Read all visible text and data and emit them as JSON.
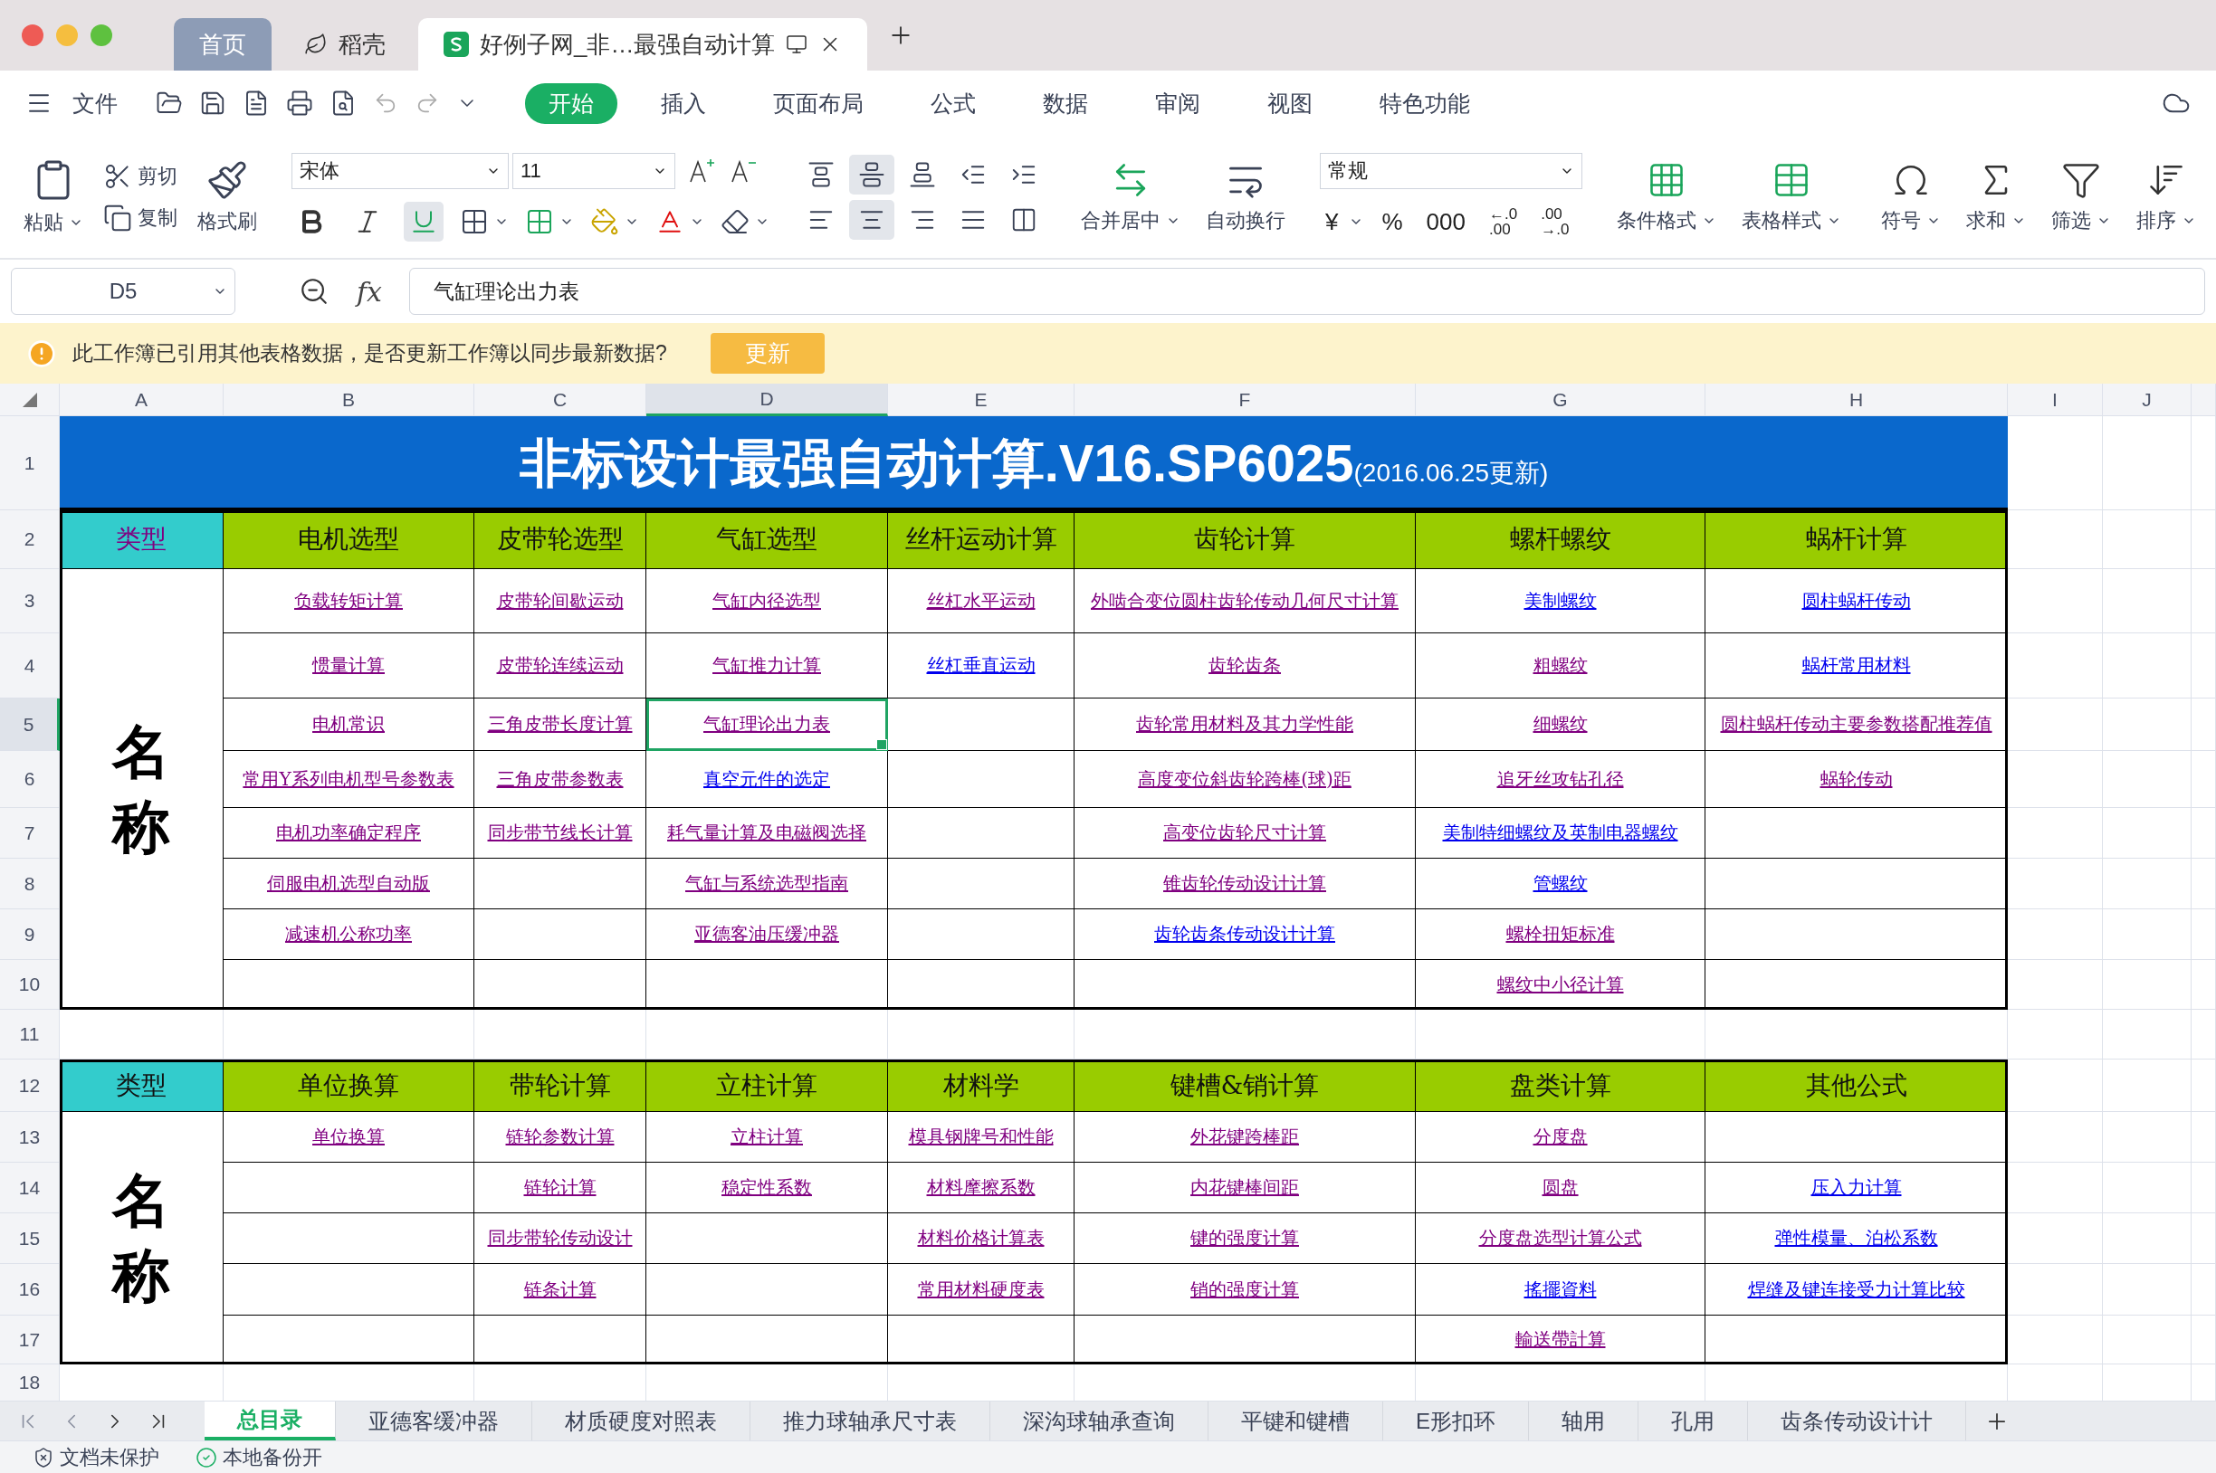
{
  "window_tabs": [
    {
      "label": "首页",
      "kind": "home",
      "selected": false
    },
    {
      "label": "稻壳",
      "kind": "store",
      "selected": false
    },
    {
      "label": "好例子网_非…最强自动计算",
      "kind": "document",
      "selected": true
    }
  ],
  "menu": {
    "file": "文件",
    "tabs": [
      {
        "label": "开始",
        "selected": true
      },
      {
        "label": "插入",
        "selected": false
      },
      {
        "label": "页面布局",
        "selected": false
      },
      {
        "label": "公式",
        "selected": false
      },
      {
        "label": "数据",
        "selected": false
      },
      {
        "label": "审阅",
        "selected": false
      },
      {
        "label": "视图",
        "selected": false
      },
      {
        "label": "特色功能",
        "selected": false
      }
    ]
  },
  "ribbon": {
    "paste": "粘贴",
    "cut": "剪切",
    "copy": "复制",
    "format_painter": "格式刷",
    "font_name": "宋体",
    "font_size": "11",
    "format_buttons": [
      {
        "kind": "bold",
        "selected": false
      },
      {
        "kind": "italic",
        "selected": false
      },
      {
        "kind": "underline",
        "selected": true
      }
    ],
    "align_buttons": [
      {
        "kind": "top",
        "selected": false
      },
      {
        "kind": "middle",
        "selected": true
      },
      {
        "kind": "bottom",
        "selected": false
      },
      {
        "kind": "outdent",
        "selected": false
      },
      {
        "kind": "indent",
        "selected": false
      },
      {
        "kind": "left",
        "selected": false
      },
      {
        "kind": "center",
        "selected": true
      },
      {
        "kind": "right",
        "selected": false
      },
      {
        "kind": "justify",
        "selected": false
      },
      {
        "kind": "distribute",
        "selected": false
      }
    ],
    "merge": "合并居中",
    "wrap": "自动换行",
    "number_format": "常规",
    "number_buttons": [
      {
        "kind": "dropdown",
        "label": "¥"
      },
      {
        "kind": "plain",
        "label": "%"
      },
      {
        "kind": "plain",
        "label": "000"
      },
      {
        "kind": "stack",
        "label": "←.0 .00"
      },
      {
        "kind": "stack",
        "label": ".00 →.0"
      }
    ],
    "tools": [
      {
        "kind": "conditional",
        "label": "条件格式"
      },
      {
        "kind": "table_style",
        "label": "表格样式"
      },
      {
        "kind": "symbol",
        "label": "符号"
      },
      {
        "kind": "sum",
        "label": "求和"
      },
      {
        "kind": "filter",
        "label": "筛选"
      },
      {
        "kind": "sort",
        "label": "排序"
      }
    ]
  },
  "formula_bar": {
    "name_box": "D5",
    "function_label": "fx",
    "formula": "气缸理论出力表"
  },
  "notice": {
    "message": "此工作簿已引用其他表格数据，是否更新工作簿以同步最新数据?",
    "button": "更新"
  },
  "sheet": {
    "column_letters": [
      {
        "label": "A",
        "selected": false
      },
      {
        "label": "B",
        "selected": false
      },
      {
        "label": "C",
        "selected": false
      },
      {
        "label": "D",
        "selected": true
      },
      {
        "label": "E",
        "selected": false
      },
      {
        "label": "F",
        "selected": false
      },
      {
        "label": "G",
        "selected": false
      },
      {
        "label": "H",
        "selected": false
      },
      {
        "label": "I",
        "selected": false
      },
      {
        "label": "J",
        "selected": false
      }
    ],
    "row_numbers": [
      {
        "label": "1",
        "selected": false
      },
      {
        "label": "2",
        "selected": false
      },
      {
        "label": "3",
        "selected": false
      },
      {
        "label": "4",
        "selected": false
      },
      {
        "label": "5",
        "selected": true
      },
      {
        "label": "6",
        "selected": false
      },
      {
        "label": "7",
        "selected": false
      },
      {
        "label": "8",
        "selected": false
      },
      {
        "label": "9",
        "selected": false
      },
      {
        "label": "10",
        "selected": false
      },
      {
        "label": "11",
        "selected": false
      },
      {
        "label": "12",
        "selected": false
      },
      {
        "label": "13",
        "selected": false
      },
      {
        "label": "14",
        "selected": false
      },
      {
        "label": "15",
        "selected": false
      },
      {
        "label": "16",
        "selected": false
      },
      {
        "label": "17",
        "selected": false
      },
      {
        "label": "18",
        "selected": false
      }
    ],
    "title": {
      "main": "非标设计最强自动计算.V16.SP6025",
      "note": "(2016.06.25更新)"
    },
    "sections": [
      {
        "type_label": {
          "text": "类型",
          "link": true
        },
        "name_label": "名称",
        "headings": [
          "电机选型",
          "皮带轮选型",
          "气缸选型",
          "丝杆运动计算",
          "齿轮计算",
          "螺杆螺纹",
          "蜗杆计算"
        ],
        "rows": [
          [
            {
              "text": "负载转矩计算",
              "visited": true,
              "selected": false
            },
            {
              "text": "皮带轮间歇运动",
              "visited": true,
              "selected": false
            },
            {
              "text": "气缸内径选型",
              "visited": true,
              "selected": false
            },
            {
              "text": "丝杠水平运动",
              "visited": true,
              "selected": false
            },
            {
              "text": "外啮合变位圆柱齿轮传动几何尺寸计算",
              "visited": true,
              "selected": false
            },
            {
              "text": "美制螺纹",
              "visited": false,
              "selected": false
            },
            {
              "text": "圆柱蜗杆传动",
              "visited": false,
              "selected": false
            }
          ],
          [
            {
              "text": "惯量计算",
              "visited": true,
              "selected": false
            },
            {
              "text": "皮带轮连续运动",
              "visited": true,
              "selected": false
            },
            {
              "text": "气缸推力计算",
              "visited": true,
              "selected": false
            },
            {
              "text": "丝杠垂直运动",
              "visited": false,
              "selected": false
            },
            {
              "text": "齿轮齿条",
              "visited": true,
              "selected": false
            },
            {
              "text": "粗螺纹",
              "visited": true,
              "selected": false
            },
            {
              "text": "蜗杆常用材料",
              "visited": false,
              "selected": false
            }
          ],
          [
            {
              "text": "电机常识",
              "visited": true,
              "selected": false
            },
            {
              "text": "三角皮带长度计算",
              "visited": true,
              "selected": false
            },
            {
              "text": "气缸理论出力表",
              "visited": true,
              "selected": true
            },
            null,
            {
              "text": "齿轮常用材料及其力学性能",
              "visited": true,
              "selected": false
            },
            {
              "text": "细螺纹",
              "visited": true,
              "selected": false
            },
            {
              "text": "圆柱蜗杆传动主要参数搭配推荐值",
              "visited": true,
              "selected": false
            }
          ],
          [
            {
              "text": "常用Y系列电机型号参数表",
              "visited": true,
              "selected": false
            },
            {
              "text": "三角皮带参数表",
              "visited": true,
              "selected": false
            },
            {
              "text": "真空元件的选定",
              "visited": false,
              "selected": false
            },
            null,
            {
              "text": "高度变位斜齿轮跨棒(球)距",
              "visited": true,
              "selected": false
            },
            {
              "text": "追牙丝攻钻孔径",
              "visited": true,
              "selected": false
            },
            {
              "text": "蜗轮传动",
              "visited": true,
              "selected": false
            }
          ],
          [
            {
              "text": "电机功率确定程序",
              "visited": true,
              "selected": false
            },
            {
              "text": "同步带节线长计算",
              "visited": true,
              "selected": false
            },
            {
              "text": "耗气量计算及电磁阀选择",
              "visited": true,
              "selected": false
            },
            null,
            {
              "text": "高变位齿轮尺寸计算",
              "visited": true,
              "selected": false
            },
            {
              "text": "美制特细螺纹及英制电器螺纹",
              "visited": false,
              "selected": false
            },
            null
          ],
          [
            {
              "text": "伺服电机选型自动版",
              "visited": true,
              "selected": false
            },
            null,
            {
              "text": "气缸与系统选型指南",
              "visited": true,
              "selected": false
            },
            null,
            {
              "text": "锥齿轮传动设计计算",
              "visited": true,
              "selected": false
            },
            {
              "text": "管螺纹",
              "visited": false,
              "selected": false
            },
            null
          ],
          [
            {
              "text": "减速机公称功率",
              "visited": true,
              "selected": false
            },
            null,
            {
              "text": "亚德客油压缓冲器",
              "visited": true,
              "selected": false
            },
            null,
            {
              "text": "齿轮齿条传动设计计算",
              "visited": false,
              "selected": false
            },
            {
              "text": "螺栓扭矩标准",
              "visited": true,
              "selected": false
            },
            null
          ],
          [
            null,
            null,
            null,
            null,
            null,
            {
              "text": "螺纹中小径计算",
              "visited": true,
              "selected": false
            },
            null
          ]
        ]
      },
      {
        "type_label": {
          "text": "类型",
          "link": false
        },
        "name_label": "名称",
        "headings": [
          "单位换算",
          "带轮计算",
          "立柱计算",
          "材料学",
          "键槽&销计算",
          "盘类计算",
          "其他公式"
        ],
        "rows": [
          [
            {
              "text": "单位换算",
              "visited": true,
              "selected": false
            },
            {
              "text": "链轮参数计算",
              "visited": true,
              "selected": false
            },
            {
              "text": "立柱计算",
              "visited": true,
              "selected": false
            },
            {
              "text": "模具钢牌号和性能",
              "visited": true,
              "selected": false
            },
            {
              "text": "外花键跨棒距",
              "visited": true,
              "selected": false
            },
            {
              "text": "分度盘",
              "visited": true,
              "selected": false
            },
            null
          ],
          [
            null,
            {
              "text": "链轮计算",
              "visited": true,
              "selected": false
            },
            {
              "text": "稳定性系数",
              "visited": true,
              "selected": false
            },
            {
              "text": "材料摩擦系数",
              "visited": true,
              "selected": false
            },
            {
              "text": "内花键棒间距",
              "visited": true,
              "selected": false
            },
            {
              "text": "圆盘",
              "visited": true,
              "selected": false
            },
            {
              "text": "压入力计算",
              "visited": false,
              "selected": false
            }
          ],
          [
            null,
            {
              "text": "同步带轮传动设计",
              "visited": true,
              "selected": false
            },
            null,
            {
              "text": "材料价格计算表",
              "visited": true,
              "selected": false
            },
            {
              "text": "键的强度计算",
              "visited": true,
              "selected": false
            },
            {
              "text": "分度盘选型计算公式",
              "visited": true,
              "selected": false
            },
            {
              "text": "弹性模量、泊松系数",
              "visited": false,
              "selected": false
            }
          ],
          [
            null,
            {
              "text": "链条计算",
              "visited": true,
              "selected": false
            },
            null,
            {
              "text": "常用材料硬度表",
              "visited": true,
              "selected": false
            },
            {
              "text": "销的强度计算",
              "visited": true,
              "selected": false
            },
            {
              "text": "搖擺資料",
              "visited": false,
              "selected": false
            },
            {
              "text": "焊缝及键连接受力计算比较",
              "visited": false,
              "selected": false
            }
          ],
          [
            null,
            null,
            null,
            null,
            null,
            {
              "text": "輸送帶計算",
              "visited": true,
              "selected": false
            },
            null
          ]
        ]
      }
    ]
  },
  "sheet_tabs": [
    {
      "label": "总目录",
      "selected": true
    },
    {
      "label": "亚德客缓冲器",
      "selected": false
    },
    {
      "label": "材质硬度对照表",
      "selected": false
    },
    {
      "label": "推力球轴承尺寸表",
      "selected": false
    },
    {
      "label": "深沟球轴承查询",
      "selected": false
    },
    {
      "label": "平键和键槽",
      "selected": false
    },
    {
      "label": "E形扣环",
      "selected": false
    },
    {
      "label": "轴用",
      "selected": false
    },
    {
      "label": "孔用",
      "selected": false
    },
    {
      "label": "齿条传动设计计",
      "selected": false
    }
  ],
  "status_bar": [
    "文档未保护",
    "本地备份开"
  ]
}
